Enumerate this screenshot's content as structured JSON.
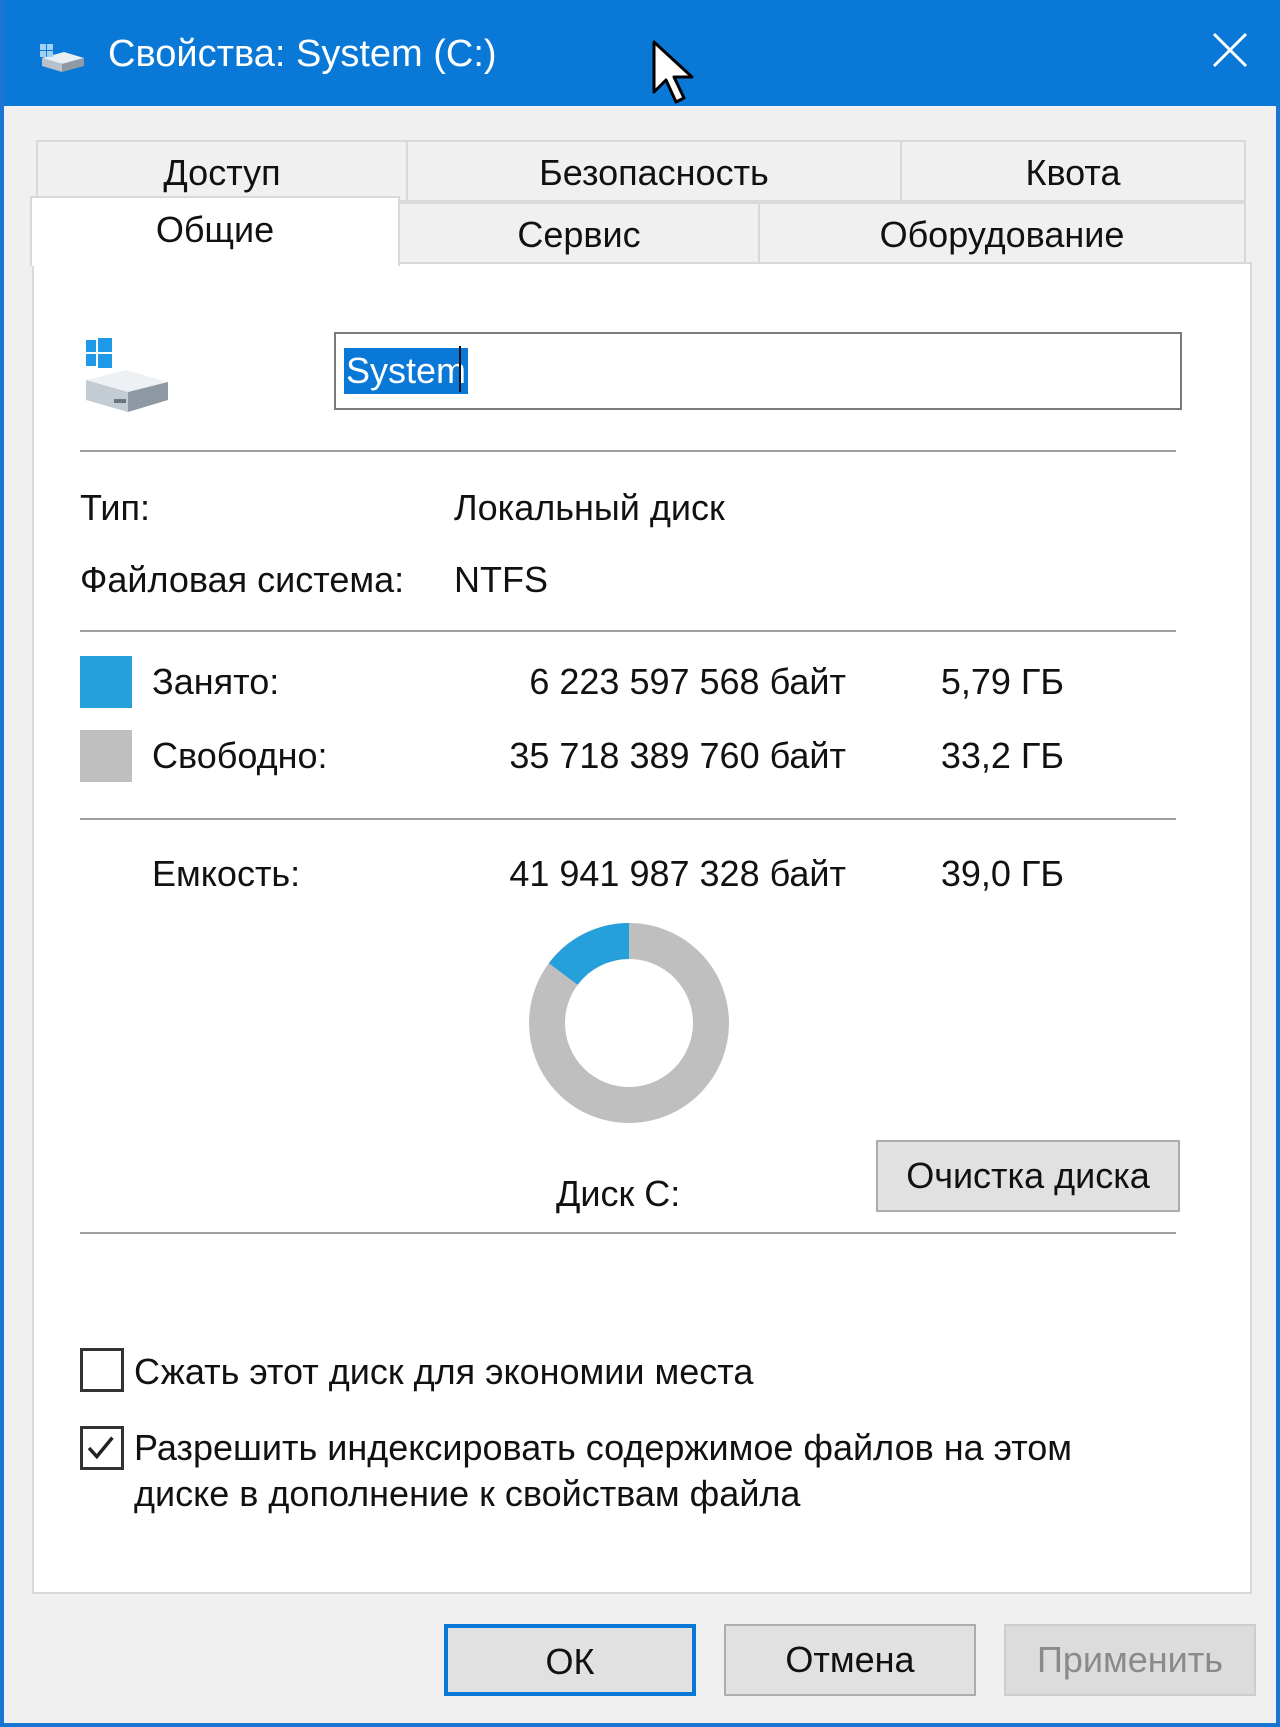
{
  "window": {
    "title": "Свойства: System (C:)"
  },
  "tabs": {
    "row1": [
      "Доступ",
      "Безопасность",
      "Квота"
    ],
    "row2": [
      "Общие",
      "Сервис",
      "Оборудование"
    ],
    "active": "Общие"
  },
  "general": {
    "name_value": "System",
    "type_label": "Тип:",
    "type_value": "Локальный диск",
    "fs_label": "Файловая система:",
    "fs_value": "NTFS",
    "used_label": "Занято:",
    "used_bytes": "6 223 597 568 байт",
    "used_gb": "5,79 ГБ",
    "free_label": "Свободно:",
    "free_bytes": "35 718 389 760 байт",
    "free_gb": "33,2 ГБ",
    "capacity_label": "Емкость:",
    "capacity_bytes": "41 941 987 328 байт",
    "capacity_gb": "39,0 ГБ",
    "disk_label": "Диск C:",
    "cleanup_button": "Очистка диска",
    "compress_label": "Сжать этот диск для экономии места",
    "compress_checked": false,
    "index_label_line1": "Разрешить индексировать содержимое файлов на этом",
    "index_label_line2": "диске в дополнение к свойствам файла",
    "index_checked": true
  },
  "donut": {
    "used_fraction": 0.148,
    "used_color": "#26a0da",
    "free_color": "#bfbfbf"
  },
  "footer": {
    "ok": "ОК",
    "cancel": "Отмена",
    "apply": "Применить"
  },
  "colors": {
    "titlebar": "#0a78d7",
    "accent": "#0a78d7",
    "used": "#26a0da",
    "free": "#bfbfbf"
  }
}
